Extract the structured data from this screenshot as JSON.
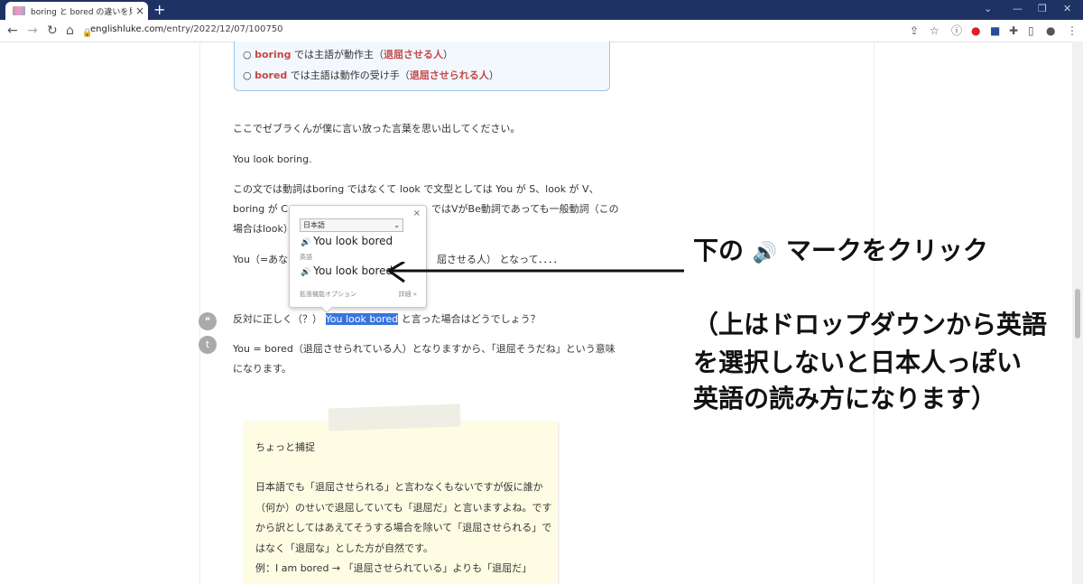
{
  "browser": {
    "tab_title": "boring と bored の違いを見分けるカギ",
    "tab_close": "×",
    "new_tab": "+",
    "url_host": "englishluke.com",
    "url_path": "/entry/2022/12/07/100750"
  },
  "rule_box": {
    "line1": {
      "circle": "○ ",
      "word": "boring",
      "mid": " では主語が動作主（",
      "hl": "退屈させる人",
      "end": "）"
    },
    "line2": {
      "circle": "○ ",
      "word": "bored",
      "mid": " では主語は動作の受け手（",
      "hl": "退屈させられる人",
      "end": "）"
    }
  },
  "article": {
    "p1": "ここでゼブラくんが僕に言い放った言葉を思い出してください。",
    "p2": "You look boring.",
    "p3a": "この文では動詞はboring ではなくて look で文型としては You が S、look が V、",
    "p3b_left": "boring が C",
    "p3b_right": "ではVがBe動詞であっても一般動詞（この",
    "p3c": "場合はlook）",
    "p4_left": "You（=あな",
    "p4_right": "屈させる人） となって．．．．",
    "p5_before": "反対に正しく（？） ",
    "p5_hl": "You look bored",
    "p5_after": " と言った場合はどうでしょう？",
    "p6a": "You = bored（退屈させられている人）となりますから、「退屈そうだね」という意味",
    "p6b": "になります。"
  },
  "social": {
    "quote": "❝",
    "twitter": "t"
  },
  "popup": {
    "close": "×",
    "select_value": "日本語",
    "line1": "You look bored",
    "lang_label": "英語",
    "line2": "You look bored",
    "options": "拡張機能オプション",
    "details": "詳細 »"
  },
  "annotation": {
    "line1_a": "下の",
    "line1_b": "マークをクリック",
    "line2": "（上はドロップダウンから英語",
    "line3": "を選択しないと日本人っぽい",
    "line4": "英語の読み方になります）"
  },
  "note": {
    "title": "ちょっと捕捉",
    "l1": "日本語でも「退屈させられる」と言わなくもないですが仮に誰か",
    "l2": "（何か）のせいで退屈していても「退屈だ」と言いますよね。です",
    "l3": "から訳としてはあえてそうする場合を除いて「退屈させられる」で",
    "l4": "はなく「退屈な」とした方が自然です。",
    "l5": "例：I am bored → 「退屈させられている」よりも「退屈だ」"
  },
  "colors": {
    "accent_red": "#c44848",
    "highlight": "#3874e0",
    "tabbar": "#1f3264"
  }
}
